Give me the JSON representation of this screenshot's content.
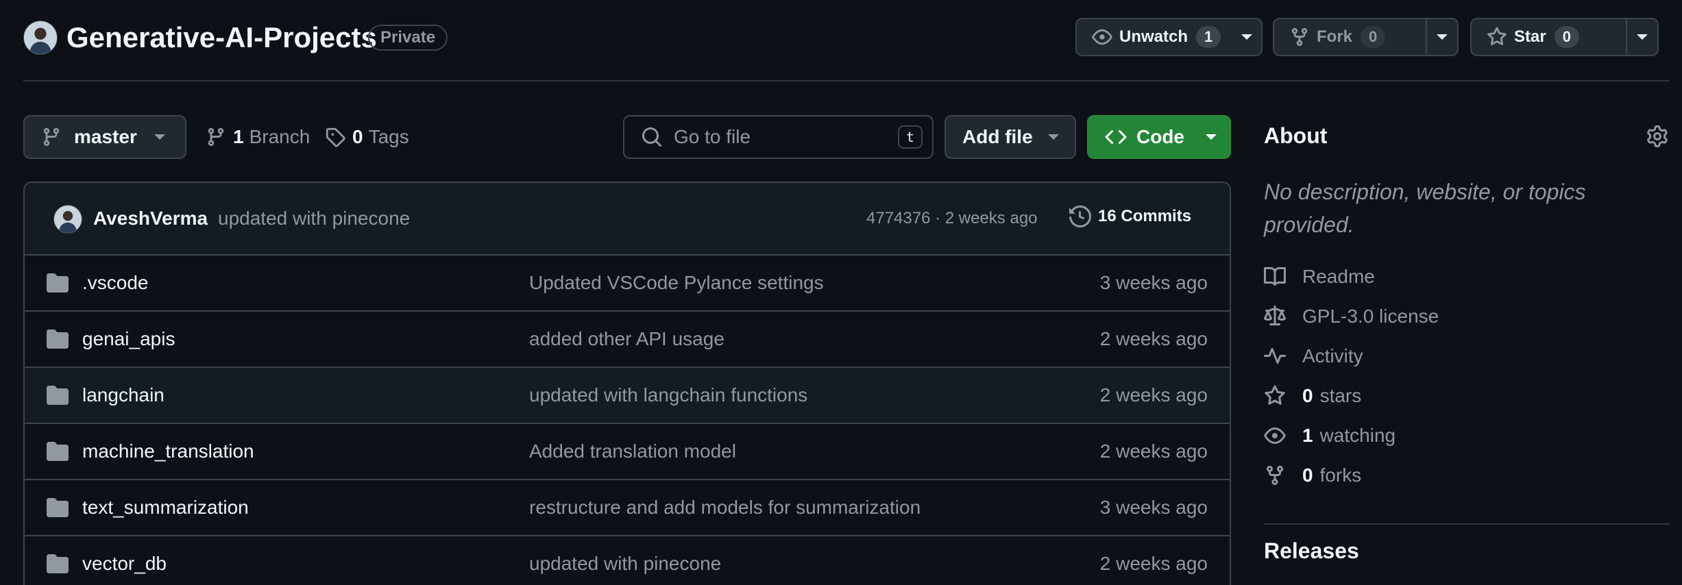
{
  "repo": {
    "name": "Generative-AI-Projects",
    "visibility": "Private"
  },
  "actions": {
    "watch_label": "Unwatch",
    "watch_count": "1",
    "fork_label": "Fork",
    "fork_count": "0",
    "star_label": "Star",
    "star_count": "0"
  },
  "toolbar": {
    "branch": "master",
    "branch_count": "1",
    "branch_label": "Branch",
    "tag_count": "0",
    "tag_label": "Tags",
    "goto_placeholder": "Go to file",
    "goto_shortcut": "t",
    "add_file_label": "Add file",
    "code_label": "Code"
  },
  "latest_commit": {
    "author": "AveshVerma",
    "message": "updated with pinecone",
    "meta": "4774376 · 2 weeks ago",
    "commits_label": "16 Commits"
  },
  "files": [
    {
      "name": ".vscode",
      "message": "Updated VSCode Pylance settings",
      "age": "3 weeks ago"
    },
    {
      "name": "genai_apis",
      "message": "added other API usage",
      "age": "2 weeks ago"
    },
    {
      "name": "langchain",
      "message": "updated with langchain functions",
      "age": "2 weeks ago"
    },
    {
      "name": "machine_translation",
      "message": "Added translation model",
      "age": "2 weeks ago"
    },
    {
      "name": "text_summarization",
      "message": "restructure and add models for summarization",
      "age": "3 weeks ago"
    },
    {
      "name": "vector_db",
      "message": "updated with pinecone",
      "age": "2 weeks ago"
    }
  ],
  "about": {
    "title": "About",
    "description": "No description, website, or topics provided.",
    "readme": "Readme",
    "license": "GPL-3.0 license",
    "activity": "Activity",
    "stars_count": "0",
    "stars_label": "stars",
    "watching_count": "1",
    "watching_label": "watching",
    "forks_count": "0",
    "forks_label": "forks"
  },
  "releases": {
    "title": "Releases"
  },
  "colors": {
    "background": "#0d1117",
    "code_button": "#238636",
    "border": "#3d444d",
    "muted_text": "#9198a1"
  }
}
